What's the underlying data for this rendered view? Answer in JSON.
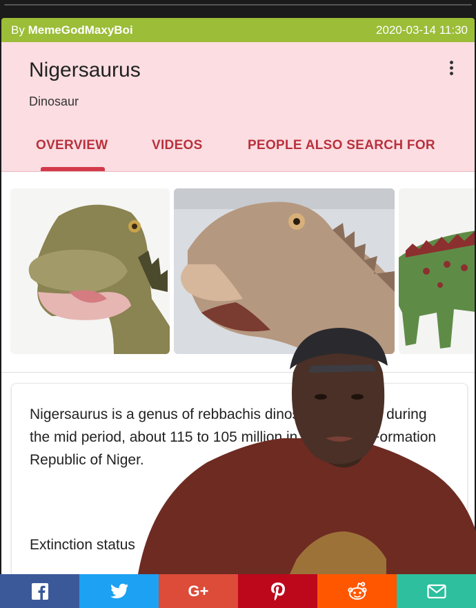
{
  "meta": {
    "by_prefix": "By",
    "author": "MemeGodMaxyBoi",
    "timestamp": "2020-03-14 11:30"
  },
  "knowledge_card": {
    "title": "Nigersaurus",
    "subtitle": "Dinosaur",
    "tabs": [
      {
        "label": "OVERVIEW",
        "active": true
      },
      {
        "label": "VIDEOS",
        "active": false
      },
      {
        "label": "PEOPLE ALSO SEARCH FOR",
        "active": false
      }
    ],
    "description": "Nigersaurus is a genus of rebbachis dinosaur that lived during the mid period, about 115 to 105 million in the Elrhaz Formation Republic of Niger.",
    "extinction_label": "Extinction status"
  },
  "share": {
    "buttons": [
      {
        "name": "facebook",
        "icon": "facebook-icon",
        "color": "#3b5999"
      },
      {
        "name": "twitter",
        "icon": "twitter-icon",
        "color": "#1da1f2"
      },
      {
        "name": "google-plus",
        "icon": "google-plus-icon",
        "color": "#dd4b39"
      },
      {
        "name": "pinterest",
        "icon": "pinterest-icon",
        "color": "#bd081c"
      },
      {
        "name": "reddit",
        "icon": "reddit-icon",
        "color": "#ff5700"
      },
      {
        "name": "email",
        "icon": "mail-icon",
        "color": "#2dbf9e"
      }
    ],
    "gplus_glyph": "G+"
  },
  "colors": {
    "meta_bar": "#9bbd38",
    "card_header": "#fbdde2",
    "tab_accent": "#b8313c"
  }
}
